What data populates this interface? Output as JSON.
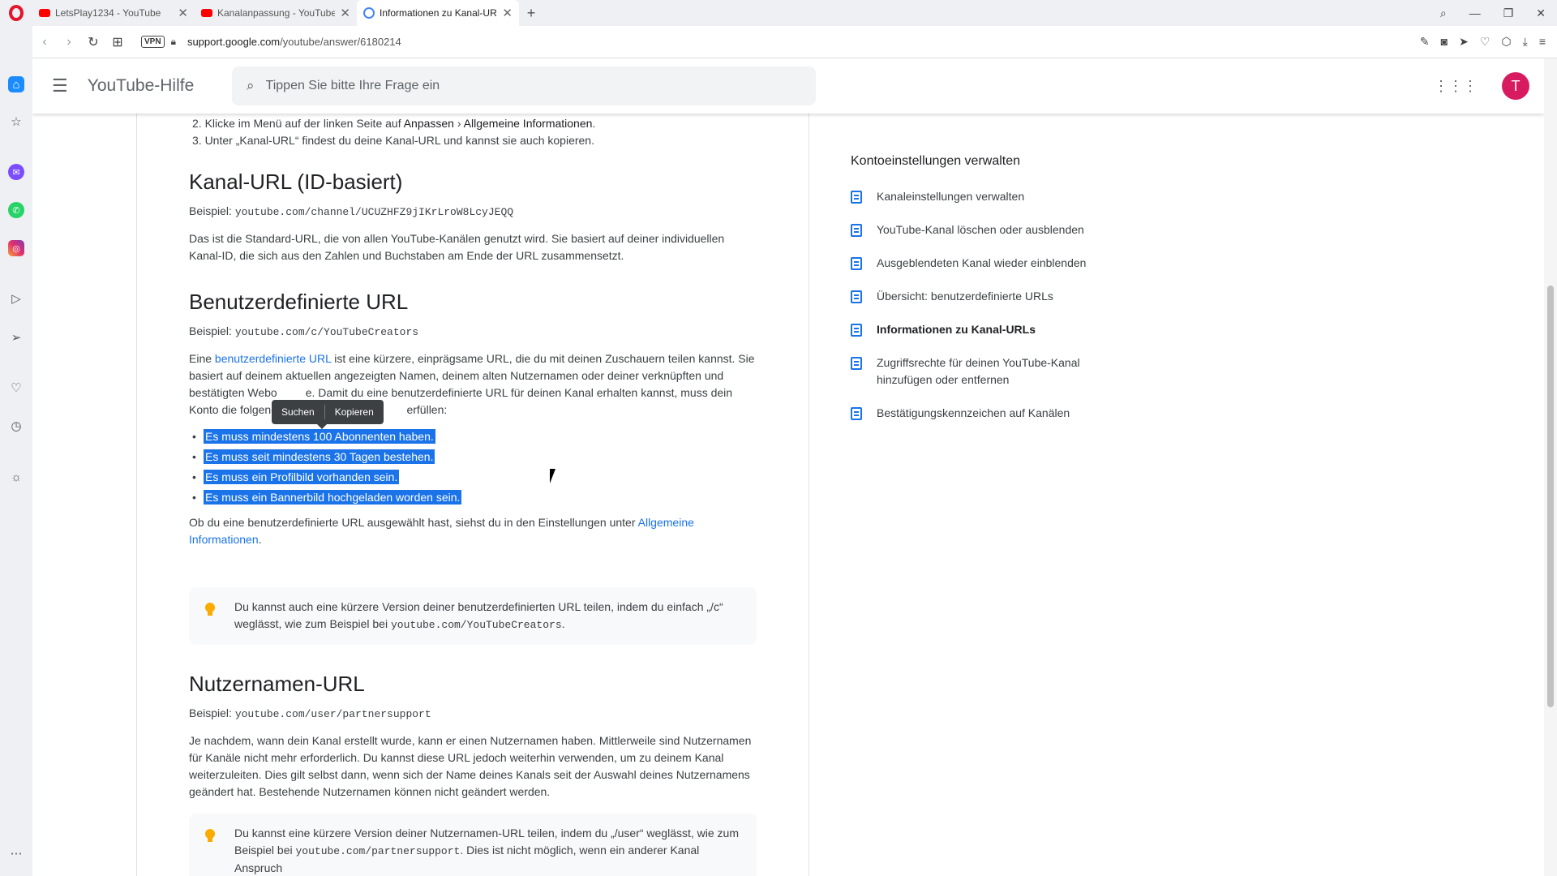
{
  "browser": {
    "tabs": [
      {
        "title": "LetsPlay1234 - YouTube",
        "favicon": "youtube-icon"
      },
      {
        "title": "Kanalanpassung - YouTube",
        "favicon": "youtube-icon"
      },
      {
        "title": "Informationen zu Kanal-URLs",
        "favicon": "google-icon",
        "active": true
      }
    ],
    "new_tab_label": "+",
    "vpn_label": "VPN",
    "url_domain": "support.google.com",
    "url_path": "/youtube/answer/6180214"
  },
  "header": {
    "brand": "YouTube-Hilfe",
    "search_placeholder": "Tippen Sie bitte Ihre Frage ein",
    "avatar_letter": "T"
  },
  "article": {
    "steps": {
      "step2_prefix": "2. Klicke im Menü auf der linken Seite auf ",
      "step2_anpassen": "Anpassen",
      "step2_sep": " › ",
      "step2_allgemein": "Allgemeine Informationen",
      "step2_suffix": ".",
      "step3": "3. Unter „Kanal-URL“ findest du deine Kanal-URL und kannst sie auch kopieren."
    },
    "section_id": {
      "title": "Kanal-URL (ID-basiert)",
      "example_label": "Beispiel: ",
      "example_url": "youtube.com/channel/UCUZHFZ9jIKrLroW8LcyJEQQ",
      "text": "Das ist die Standard-URL, die von allen YouTube-Kanälen genutzt wird. Sie basiert auf deiner individuellen Kanal-ID, die sich aus den Zahlen und Buchstaben am Ende der URL zusammensetzt."
    },
    "section_custom": {
      "title": "Benutzerdefinierte URL",
      "example_label": "Beispiel: ",
      "example_url": "youtube.com/c/YouTubeCreators",
      "text_pre": "Eine ",
      "text_link": "benutzerdefinierte URL",
      "text_post": " ist eine kürzere, einprägsame URL, die du mit deinen Zuschauern teilen kannst. Sie basiert auf deinem aktuellen angezeigten Namen, deinem alten Nutzernamen oder deiner verknüpften und bestätigten Webo         e. Damit du eine benutzerdefinierte URL für deinen Kanal erhalten kannst, muss dein Konto die folgend                                         erfüllen:",
      "requirements": [
        "Es muss mindestens 100 Abonnenten haben.",
        "Es muss seit mindestens 30 Tagen bestehen.",
        "Es muss ein Profilbild vorhanden sein.",
        "Es muss ein Bannerbild hochgeladen worden sein."
      ],
      "after_pre": "Ob du eine benutzerdefinierte URL ausgewählt hast, siehst du in den Einstellungen unter ",
      "after_link": "Allgemeine Informationen",
      "after_post": ".",
      "tip_pre": "Du kannst auch eine kürzere Version deiner benutzerdefinierten URL teilen, indem du einfach „/c“ weglässt, wie zum Beispiel bei ",
      "tip_code": "youtube.com/YouTubeCreators",
      "tip_post": "."
    },
    "section_user": {
      "title": "Nutzernamen-URL",
      "example_label": "Beispiel: ",
      "example_url": "youtube.com/user/partnersupport",
      "text": "Je nachdem, wann dein Kanal erstellt wurde, kann er einen Nutzernamen haben. Mittlerweile sind Nutzernamen für Kanäle nicht mehr erforderlich. Du kannst diese URL jedoch weiterhin verwenden, um zu deinem Kanal weiterzuleiten. Dies gilt selbst dann, wenn sich der Name deines Kanals seit der Auswahl deines Nutzernamens geändert hat. Bestehende Nutzernamen können nicht geändert werden.",
      "tip_pre": "Du kannst eine kürzere Version deiner Nutzernamen-URL teilen, indem du „/user“ weglässt, wie zum Beispiel bei ",
      "tip_code": "youtube.com/partnersupport",
      "tip_post": ". Dies ist nicht möglich, wenn ein anderer Kanal Anspruch"
    }
  },
  "context_menu": {
    "search": "Suchen",
    "copy": "Kopieren"
  },
  "related": {
    "title": "Kontoeinstellungen verwalten",
    "items": [
      "Kanaleinstellungen verwalten",
      "YouTube-Kanal löschen oder ausblenden",
      "Ausgeblendeten Kanal wieder einblenden",
      "Übersicht: benutzerdefinierte URLs",
      "Informationen zu Kanal-URLs",
      "Zugriffsrechte für deinen YouTube-Kanal hinzufügen oder entfernen",
      "Bestätigungskennzeichen auf Kanälen"
    ]
  }
}
